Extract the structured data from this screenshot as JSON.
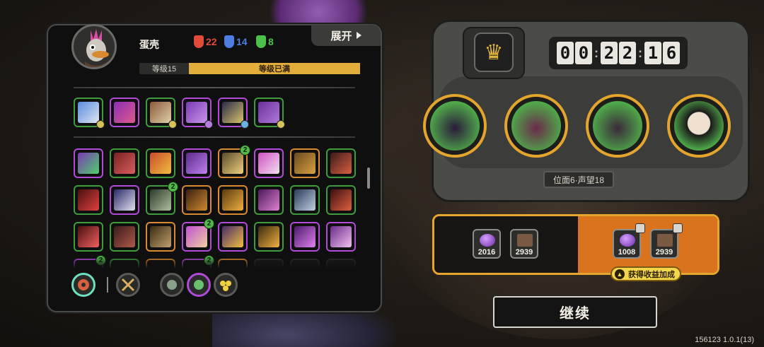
{
  "player": {
    "name": "蛋壳",
    "expand_label": "展开",
    "level_label": "等级15",
    "level_status": "等级已满",
    "resources": [
      {
        "icon": "red-mask-icon",
        "value": "22",
        "color": "#e24a3c"
      },
      {
        "icon": "blue-mask-icon",
        "value": "14",
        "color": "#4d7de0"
      },
      {
        "icon": "green-mask-icon",
        "value": "8",
        "color": "#4cc04a"
      }
    ]
  },
  "equipped_skills": {
    "badge_counts": [
      "2",
      "2",
      "2",
      "2",
      "2"
    ]
  },
  "timer": {
    "digits": [
      "0",
      "0",
      "2",
      "2",
      "1",
      "6"
    ]
  },
  "stage": {
    "label": "位面6·声望18"
  },
  "rewards": {
    "base": [
      {
        "icon": "purple-orb-icon",
        "qty": "2016"
      },
      {
        "icon": "book-icon",
        "qty": "2939"
      }
    ],
    "bonus": [
      {
        "icon": "purple-orb-icon",
        "qty": "1008"
      },
      {
        "icon": "book-icon",
        "qty": "2939"
      }
    ],
    "bonus_label": "获得收益加成"
  },
  "continue_label": "继续",
  "version": "156123 1.0.1(13)",
  "colors": {
    "accent_gold": "#e3a52e",
    "reward_orange": "#d9731e",
    "green_frame": "#3f9b3e",
    "purple_frame": "#b04ad9"
  }
}
